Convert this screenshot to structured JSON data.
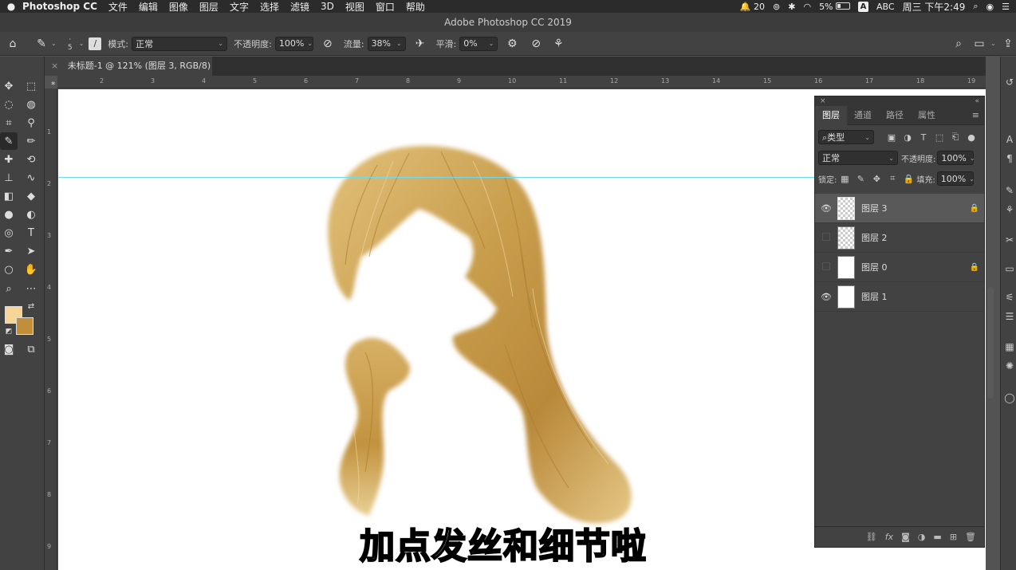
{
  "menubar": {
    "app_name": "Photoshop CC",
    "items": [
      "文件",
      "编辑",
      "图像",
      "图层",
      "文字",
      "选择",
      "滤镜",
      "3D",
      "视图",
      "窗口",
      "帮助"
    ],
    "notif_count": "20",
    "battery_pct": "5%",
    "input_source": "ABC",
    "input_badge": "A",
    "clock": "周三 下午2:49"
  },
  "window": {
    "title": "Adobe Photoshop CC 2019"
  },
  "options": {
    "brush_size": "5",
    "mode_label": "模式:",
    "mode_value": "正常",
    "opacity_label": "不透明度:",
    "opacity_value": "100%",
    "flow_label": "流量:",
    "flow_value": "38%",
    "smoothing_label": "平滑:",
    "smoothing_value": "0%"
  },
  "document": {
    "tab_title": "未标题-1 @ 121% (图层 3, RGB/8) *"
  },
  "rulers": {
    "h_marks": [
      "2",
      "3",
      "4",
      "5",
      "6",
      "7",
      "8",
      "9",
      "10",
      "11",
      "12",
      "13",
      "14",
      "15",
      "16",
      "17",
      "18",
      "19"
    ],
    "v_marks": [
      "1",
      "2",
      "3",
      "4",
      "5",
      "6",
      "7",
      "8",
      "9"
    ]
  },
  "canvas": {
    "subtitle": "加点发丝和细节啦"
  },
  "colors": {
    "foreground": "#f6d596",
    "background": "#c18f3a",
    "guide": "#6bdcf4"
  },
  "layers_panel": {
    "tabs": [
      "图层",
      "通道",
      "路径",
      "属性"
    ],
    "filter_label": "类型",
    "blend_mode": "正常",
    "opacity_label": "不透明度:",
    "opacity_value": "100%",
    "lock_label": "锁定:",
    "fill_label": "填充:",
    "fill_value": "100%",
    "layers": [
      {
        "name": "图层 3",
        "visible": true,
        "locked": true,
        "selected": true
      },
      {
        "name": "图层 2",
        "visible": false,
        "locked": false,
        "selected": false
      },
      {
        "name": "图层 0",
        "visible": false,
        "locked": true,
        "selected": false
      },
      {
        "name": "图层 1",
        "visible": true,
        "locked": false,
        "selected": false
      }
    ],
    "footer_fx": "fx"
  }
}
